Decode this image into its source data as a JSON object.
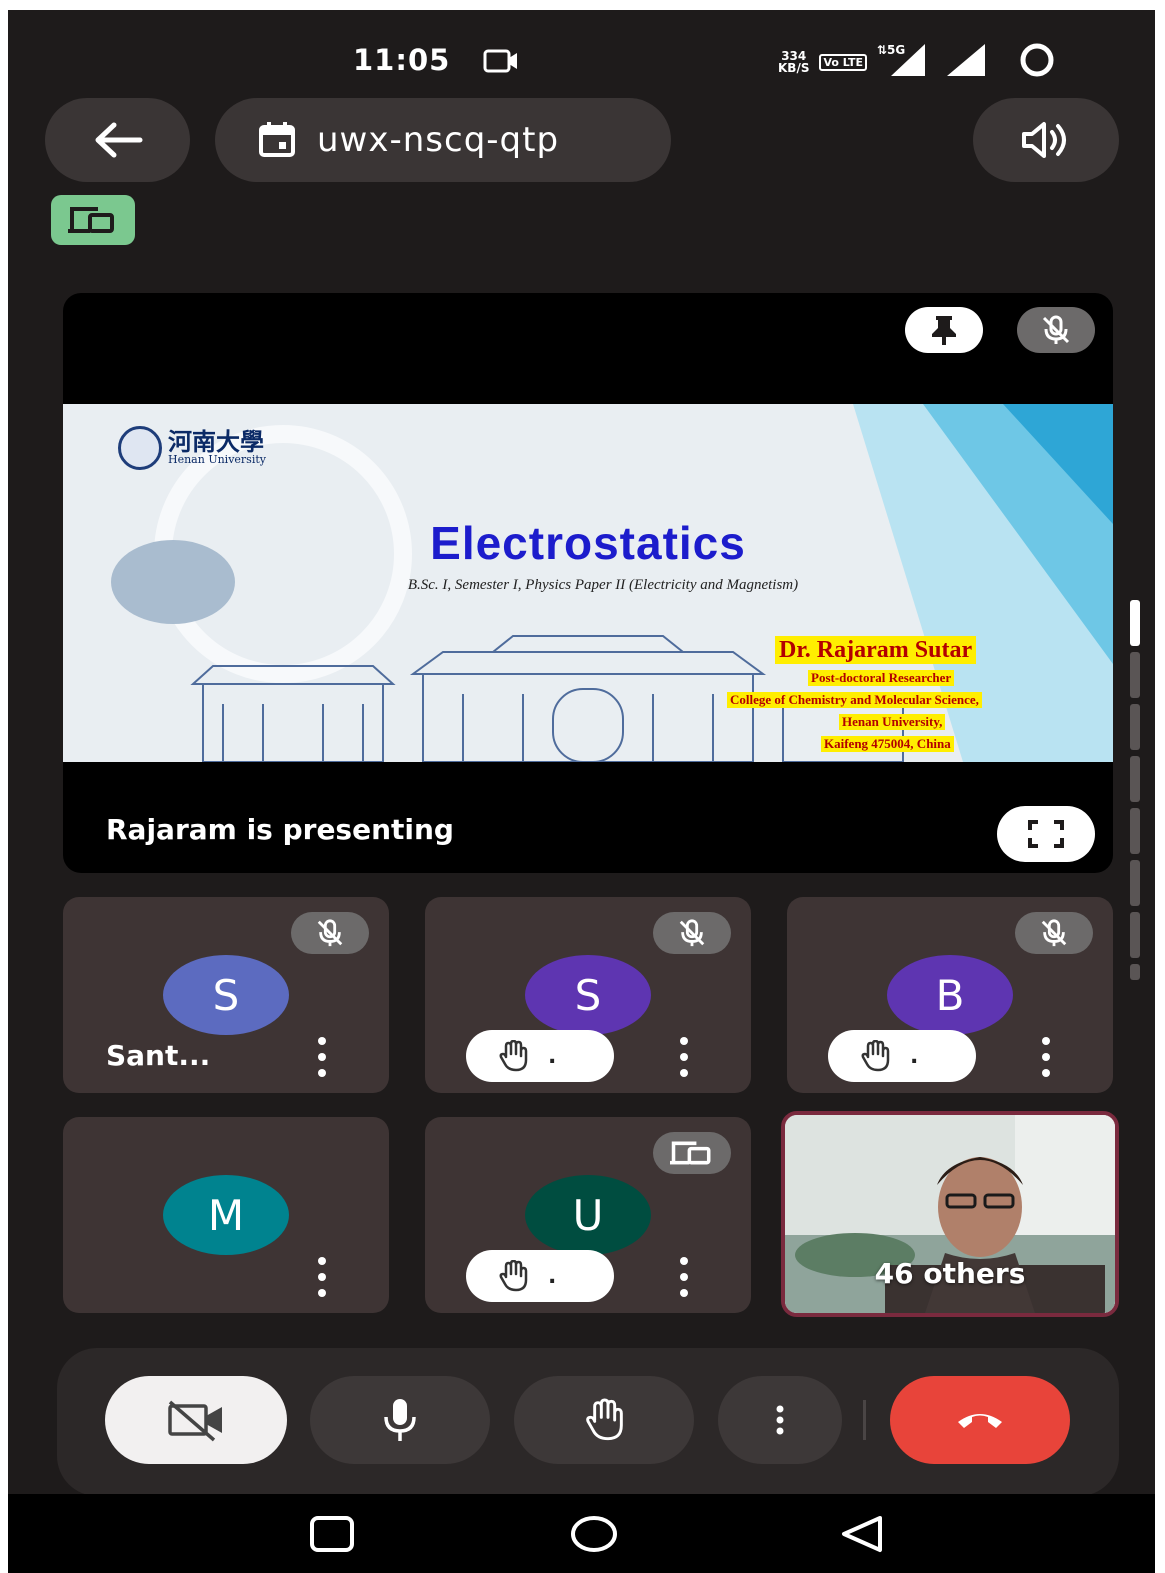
{
  "status_bar": {
    "time": "11:05",
    "speed_value": "334",
    "speed_unit": "KB/S",
    "lte_badge": "Vo LTE",
    "network": "5G"
  },
  "meeting": {
    "code": "uwx-nscq-qtp"
  },
  "presentation": {
    "presenting_label": "Rajaram is presenting",
    "slide": {
      "logo_cn": "河南大學",
      "logo_en": "Henan University",
      "title": "Electrostatics",
      "subtitle": "B.Sc. I, Semester I, Physics Paper II (Electricity and Magnetism)",
      "presenter_name": "Dr. Rajaram Sutar",
      "lines": [
        "Post-doctoral Researcher",
        "College of Chemistry and Molecular Science,",
        "Henan University,",
        "Kaifeng 475004, China"
      ]
    }
  },
  "participants": [
    {
      "initial": "S",
      "name": "Sant...",
      "color": "#5c6bc0",
      "muted": true,
      "hand_raised": false
    },
    {
      "initial": "S",
      "name": "",
      "color": "#5e35b1",
      "muted": true,
      "hand_raised": true,
      "hand_count": "."
    },
    {
      "initial": "B",
      "name": "",
      "color": "#5e35b1",
      "muted": true,
      "hand_raised": true,
      "hand_count": "."
    },
    {
      "initial": "M",
      "name": "",
      "color": "#00838f",
      "muted": false,
      "hand_raised": false
    },
    {
      "initial": "U",
      "name": "",
      "color": "#004d40",
      "muted": false,
      "presenting": true,
      "hand_raised": true,
      "hand_count": "."
    }
  ],
  "others": {
    "label": "46 others"
  },
  "colors": {
    "background": "#1e1b1b",
    "tile": "#3e3434",
    "end_call": "#e8443a",
    "presenting_badge": "#7bc88f"
  }
}
